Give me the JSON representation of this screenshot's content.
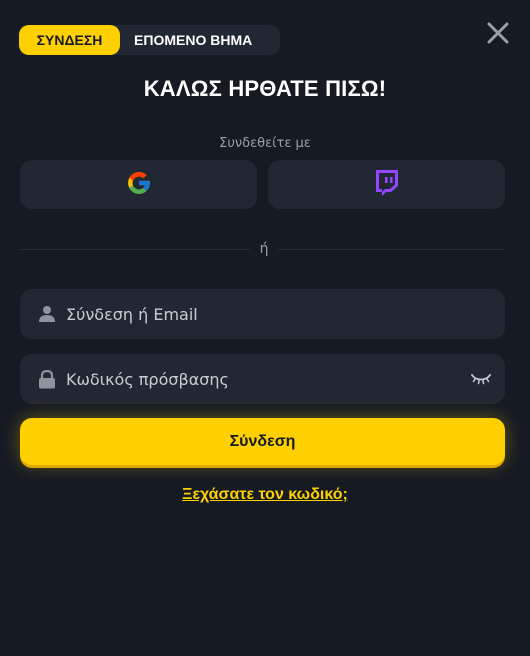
{
  "tabs": [
    {
      "label": "ΣΥΝΔΕΣΗ",
      "active": true
    },
    {
      "label": "ΕΠΟΜΕΝΟ ΒΗΜΑ",
      "active": false
    }
  ],
  "title": "ΚΑΛΩΣ ΗΡΘΑΤΕ ΠΙΣΩ!",
  "social": {
    "heading": "Συνδεθείτε με",
    "providers": [
      {
        "name": "google-icon"
      },
      {
        "name": "twitch-icon"
      }
    ]
  },
  "divider_text": "ή",
  "form": {
    "login_placeholder": "Σύνδεση ή Email",
    "login_value": "",
    "password_placeholder": "Κωδικός πρόσβασης",
    "password_value": "",
    "submit_label": "Σύνδεση",
    "forgot_label": "Ξεχάσατε τον κωδικό;"
  },
  "colors": {
    "accent": "#ffd000",
    "background": "#151a23",
    "surface": "#222833",
    "twitch": "#9146ff"
  }
}
